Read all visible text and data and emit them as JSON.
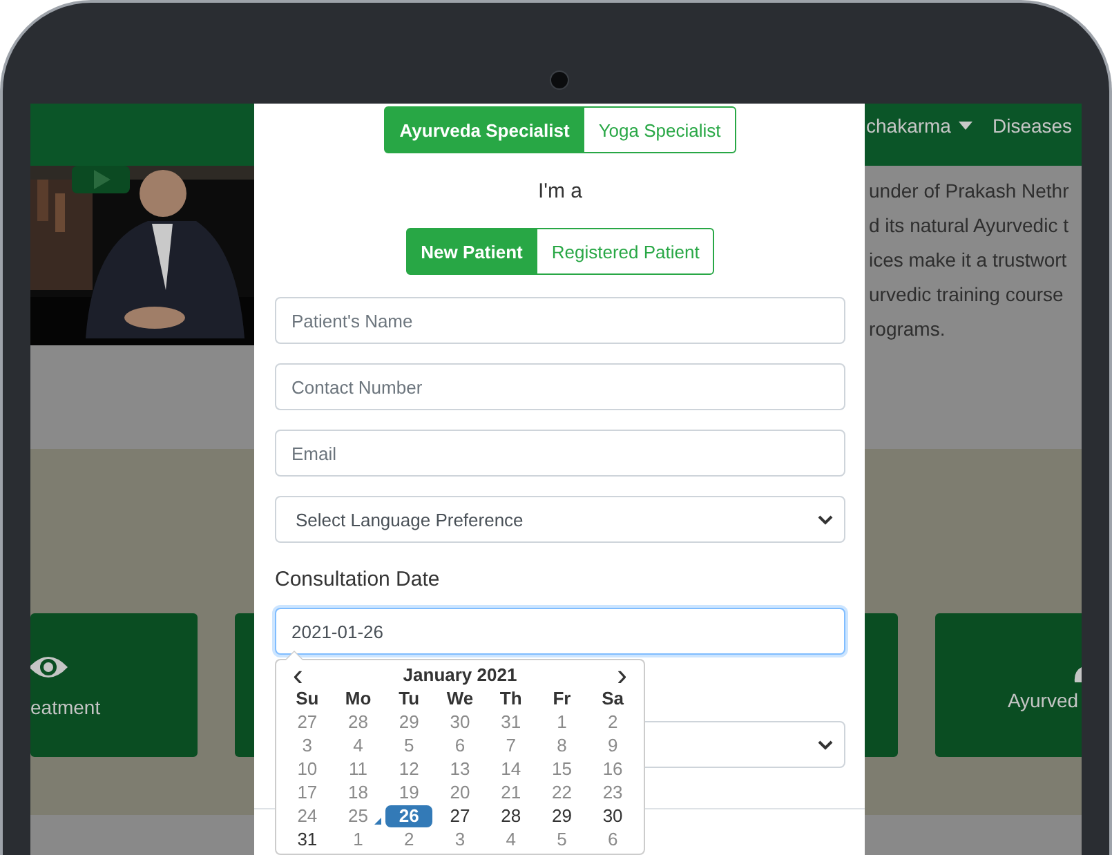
{
  "background_page": {
    "nav_items": [
      {
        "label": "chakarma",
        "dropdown": true
      },
      {
        "label": "Diseases",
        "dropdown": false
      }
    ],
    "intro_lines": [
      "under of Prakash Nethr",
      "d its natural Ayurvedic t",
      "ices make it a trustwort",
      "urvedic training course",
      "rograms."
    ],
    "cards": [
      {
        "label": "eatment"
      },
      {
        "label": "Ayurved"
      }
    ]
  },
  "modal": {
    "specialist_toggle": [
      {
        "label": "Ayurveda Specialist",
        "selected": true
      },
      {
        "label": "Yoga Specialist",
        "selected": false
      }
    ],
    "prompt": "I'm a",
    "patient_toggle": [
      {
        "label": "New Patient",
        "selected": true
      },
      {
        "label": "Registered Patient",
        "selected": false
      }
    ],
    "fields": [
      {
        "kind": "input",
        "placeholder": "Patient's Name"
      },
      {
        "kind": "input",
        "placeholder": "Contact Number"
      },
      {
        "kind": "input",
        "placeholder": "Email"
      },
      {
        "kind": "select",
        "value": "Select Language Preference"
      }
    ],
    "date_label": "Consultation Date",
    "date_field": {
      "value": "2021-01-26",
      "focused": true
    },
    "datepicker": {
      "prev": "‹",
      "next": "›",
      "month": "January 2021",
      "weekdays": [
        "Su",
        "Mo",
        "Tu",
        "We",
        "Th",
        "Fr",
        "Sa"
      ],
      "weeks": [
        [
          {
            "label": "27",
            "disabled": true,
            "selected": false,
            "today": false
          },
          {
            "label": "28",
            "disabled": true,
            "selected": false,
            "today": false
          },
          {
            "label": "29",
            "disabled": true,
            "selected": false,
            "today": false
          },
          {
            "label": "30",
            "disabled": true,
            "selected": false,
            "today": false
          },
          {
            "label": "31",
            "disabled": true,
            "selected": false,
            "today": false
          },
          {
            "label": "1",
            "disabled": true,
            "selected": false,
            "today": false
          },
          {
            "label": "2",
            "disabled": true,
            "selected": false,
            "today": false
          }
        ],
        [
          {
            "label": "3",
            "disabled": true,
            "selected": false,
            "today": false
          },
          {
            "label": "4",
            "disabled": true,
            "selected": false,
            "today": false
          },
          {
            "label": "5",
            "disabled": true,
            "selected": false,
            "today": false
          },
          {
            "label": "6",
            "disabled": true,
            "selected": false,
            "today": false
          },
          {
            "label": "7",
            "disabled": true,
            "selected": false,
            "today": false
          },
          {
            "label": "8",
            "disabled": true,
            "selected": false,
            "today": false
          },
          {
            "label": "9",
            "disabled": true,
            "selected": false,
            "today": false
          }
        ],
        [
          {
            "label": "10",
            "disabled": true,
            "selected": false,
            "today": false
          },
          {
            "label": "11",
            "disabled": true,
            "selected": false,
            "today": false
          },
          {
            "label": "12",
            "disabled": true,
            "selected": false,
            "today": false
          },
          {
            "label": "13",
            "disabled": true,
            "selected": false,
            "today": false
          },
          {
            "label": "14",
            "disabled": true,
            "selected": false,
            "today": false
          },
          {
            "label": "15",
            "disabled": true,
            "selected": false,
            "today": false
          },
          {
            "label": "16",
            "disabled": true,
            "selected": false,
            "today": false
          }
        ],
        [
          {
            "label": "17",
            "disabled": true,
            "selected": false,
            "today": false
          },
          {
            "label": "18",
            "disabled": true,
            "selected": false,
            "today": false
          },
          {
            "label": "19",
            "disabled": true,
            "selected": false,
            "today": false
          },
          {
            "label": "20",
            "disabled": true,
            "selected": false,
            "today": false
          },
          {
            "label": "21",
            "disabled": true,
            "selected": false,
            "today": false
          },
          {
            "label": "22",
            "disabled": true,
            "selected": false,
            "today": false
          },
          {
            "label": "23",
            "disabled": true,
            "selected": false,
            "today": false
          }
        ],
        [
          {
            "label": "24",
            "disabled": true,
            "selected": false,
            "today": false
          },
          {
            "label": "25",
            "disabled": true,
            "selected": false,
            "today": true
          },
          {
            "label": "26",
            "disabled": false,
            "selected": true,
            "today": false
          },
          {
            "label": "27",
            "disabled": false,
            "selected": false,
            "today": false
          },
          {
            "label": "28",
            "disabled": false,
            "selected": false,
            "today": false
          },
          {
            "label": "29",
            "disabled": false,
            "selected": false,
            "today": false
          },
          {
            "label": "30",
            "disabled": false,
            "selected": false,
            "today": false
          }
        ],
        [
          {
            "label": "31",
            "disabled": false,
            "selected": false,
            "today": false
          },
          {
            "label": "1",
            "disabled": true,
            "selected": false,
            "today": false
          },
          {
            "label": "2",
            "disabled": true,
            "selected": false,
            "today": false
          },
          {
            "label": "3",
            "disabled": true,
            "selected": false,
            "today": false
          },
          {
            "label": "4",
            "disabled": true,
            "selected": false,
            "today": false
          },
          {
            "label": "5",
            "disabled": true,
            "selected": false,
            "today": false
          },
          {
            "label": "6",
            "disabled": true,
            "selected": false,
            "today": false
          }
        ]
      ]
    }
  }
}
